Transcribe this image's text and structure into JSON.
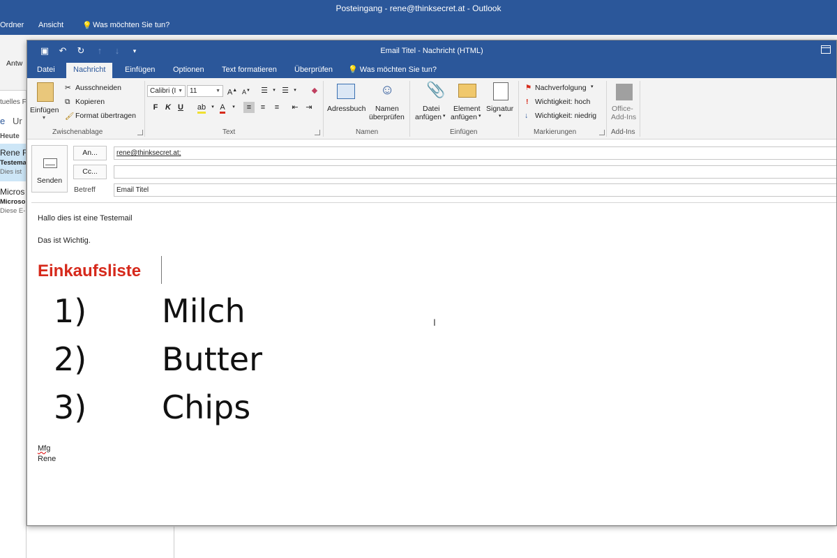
{
  "bg": {
    "title": "Posteingang - rene@thinksecret.at - Outlook",
    "tabs": [
      "Ordner",
      "Ansicht",
      "Was möchten Sie tun?"
    ],
    "reply_label": "Antw",
    "folder_label": "tuelles F",
    "filter_left": "e",
    "filter_right": "Ur",
    "group_today": "Heute",
    "mails": [
      {
        "sender": "Rene F",
        "subject": "Testema",
        "preview": "Dies ist"
      },
      {
        "sender": "Micros",
        "subject": "Microso",
        "preview": "Diese E-"
      }
    ]
  },
  "window": {
    "title": "Email Titel - Nachricht (HTML)",
    "quick_access": {
      "save": "💾",
      "undo": "↶",
      "redo": "↻",
      "up": "↑",
      "down": "↓",
      "more": "▾"
    },
    "tabs": [
      "Datei",
      "Nachricht",
      "Einfügen",
      "Optionen",
      "Text formatieren",
      "Überprüfen",
      "Was möchten Sie tun?"
    ],
    "active_tab": "Nachricht"
  },
  "ribbon": {
    "clipboard": {
      "paste": "Einfügen",
      "cut": "Ausschneiden",
      "copy": "Kopieren",
      "format_painter": "Format übertragen",
      "label": "Zwischenablage"
    },
    "text": {
      "font": "Calibri (I",
      "size": "11",
      "bold": "F",
      "italic": "K",
      "underline": "U",
      "label": "Text"
    },
    "names": {
      "address_book": "Adressbuch",
      "check_names_1": "Namen",
      "check_names_2": "überprüfen",
      "label": "Namen"
    },
    "include": {
      "attach_file_1": "Datei",
      "attach_file_2": "anfügen",
      "attach_item_1": "Element",
      "attach_item_2": "anfügen",
      "signature": "Signatur",
      "label": "Einfügen"
    },
    "tags": {
      "follow_up": "Nachverfolgung",
      "high": "Wichtigkeit: hoch",
      "low": "Wichtigkeit: niedrig",
      "label": "Markierungen"
    },
    "addins": {
      "office_1": "Office-",
      "office_2": "Add-Ins",
      "label": "Add-Ins"
    }
  },
  "compose": {
    "send_label": "Senden",
    "to_label": "An...",
    "cc_label": "Cc...",
    "subject_label": "Betreff",
    "to_value": "rene@thinksecret.at;",
    "cc_value": "",
    "subject_value": "Email Titel"
  },
  "body": {
    "line1": "Hallo dies ist eine Testemail",
    "line2": "Das ist Wichtig.",
    "heading": "Einkaufsliste",
    "list": [
      {
        "num": "1)",
        "text": "Milch"
      },
      {
        "num": "2)",
        "text": "Butter"
      },
      {
        "num": "3)",
        "text": "Chips"
      }
    ],
    "closing": "Mfg",
    "signature": "Rene"
  },
  "colors": {
    "accent": "#2b579a",
    "heading_red": "#d6291b",
    "ribbon_bg": "#f3f3f3"
  }
}
